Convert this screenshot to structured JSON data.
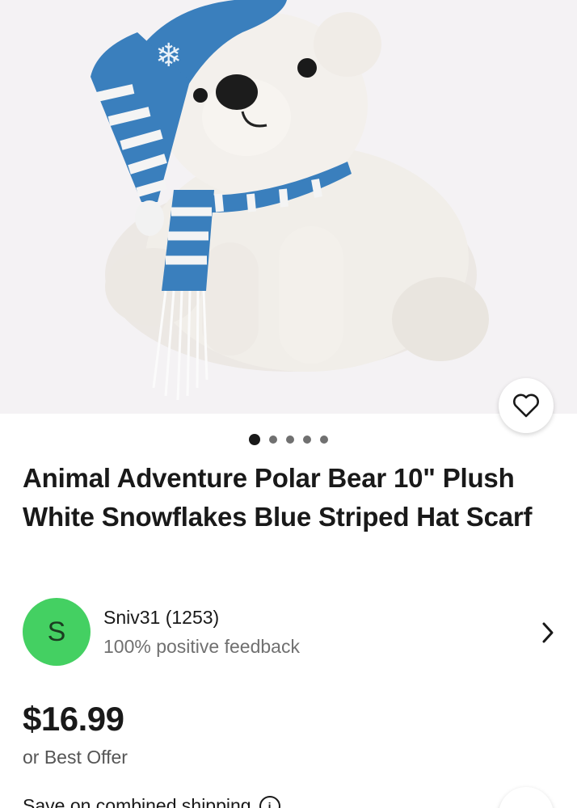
{
  "listing": {
    "title": "Animal Adventure Polar Bear 10\" Plush White Snowflakes Blue Striped Hat Scarf",
    "image_count": 5,
    "active_image": 1
  },
  "seller": {
    "initial": "S",
    "name_line": "Sniv31 (1253)",
    "feedback": "100% positive feedback"
  },
  "pricing": {
    "price": "$16.99",
    "offer_text": "or Best Offer"
  },
  "shipping": {
    "text": "Save on combined shipping"
  },
  "icons": {
    "favorite": "heart-icon",
    "seller_link": "chevron-right-icon",
    "info": "info-icon"
  },
  "colors": {
    "avatar_bg": "#44d062",
    "hat_blue": "#3a7fbd"
  }
}
